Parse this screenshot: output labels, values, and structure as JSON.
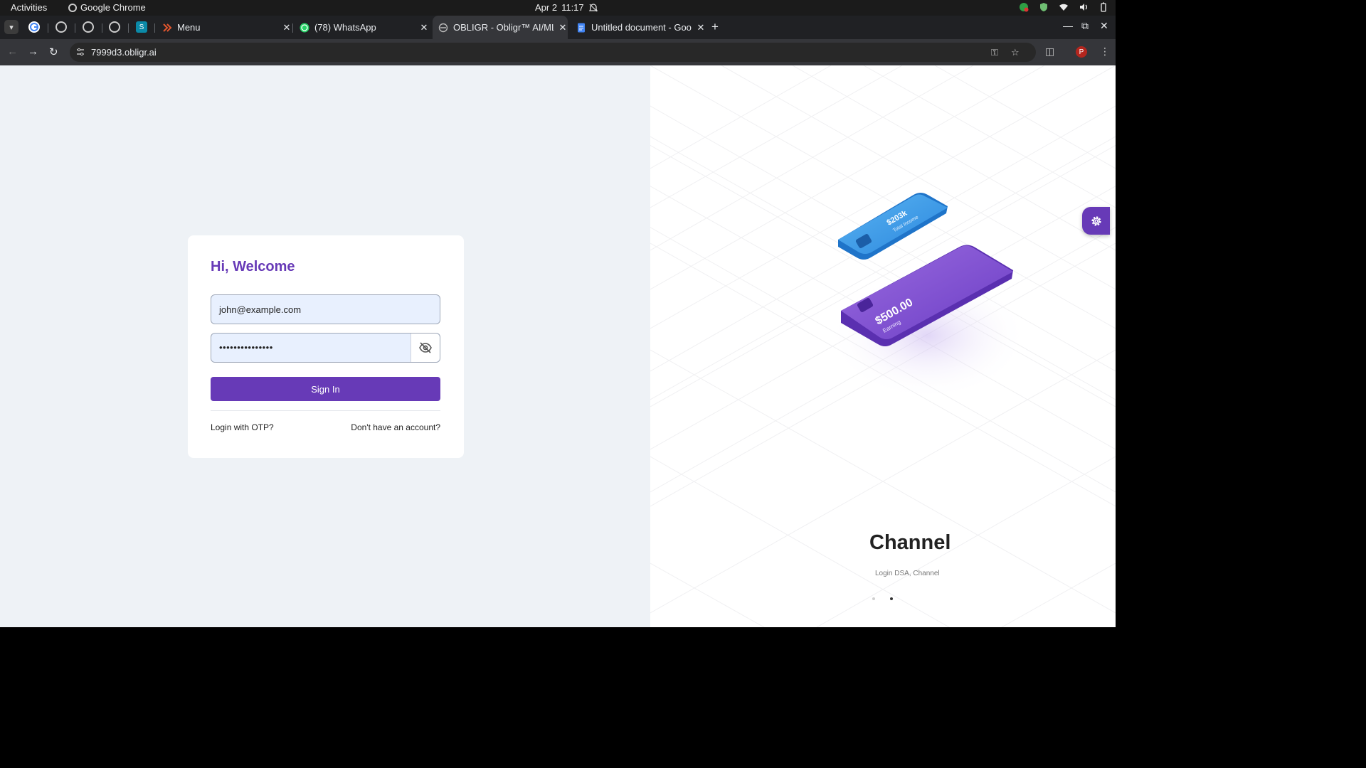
{
  "system_bar": {
    "activities": "Activities",
    "app_name": "Google Chrome",
    "date": "Apr 2",
    "time": "11:17"
  },
  "browser": {
    "tabs": [
      {
        "title": "Menu",
        "favicon": "menu-favicon"
      },
      {
        "title": "(78) WhatsApp",
        "favicon": "whatsapp-favicon"
      },
      {
        "title": "OBLIGR - Obligr™ AI/ML",
        "favicon": "obligr-favicon"
      },
      {
        "title": "Untitled document - Goo",
        "favicon": "google-docs-favicon"
      }
    ],
    "url": "7999d3.obligr.ai",
    "profile_initial": "P"
  },
  "login": {
    "heading": "Hi, Welcome",
    "email_value": "john@example.com",
    "password_value": "•••••••••••••••",
    "sign_in": "Sign In",
    "otp_link": "Login with OTP?",
    "signup_link": "Don't have an account?"
  },
  "illustration": {
    "income_amount": "$203k",
    "income_label": "Total Income",
    "earning_amount": "$500.00",
    "earning_label": "Earning"
  },
  "carousel": {
    "title": "Channel",
    "subtitle": "Login DSA, Channel",
    "active_index": 1,
    "count": 2
  },
  "colors": {
    "brand": "#673ab7",
    "page_bg": "#eef2f6",
    "card_blue": "#2f95e6"
  }
}
